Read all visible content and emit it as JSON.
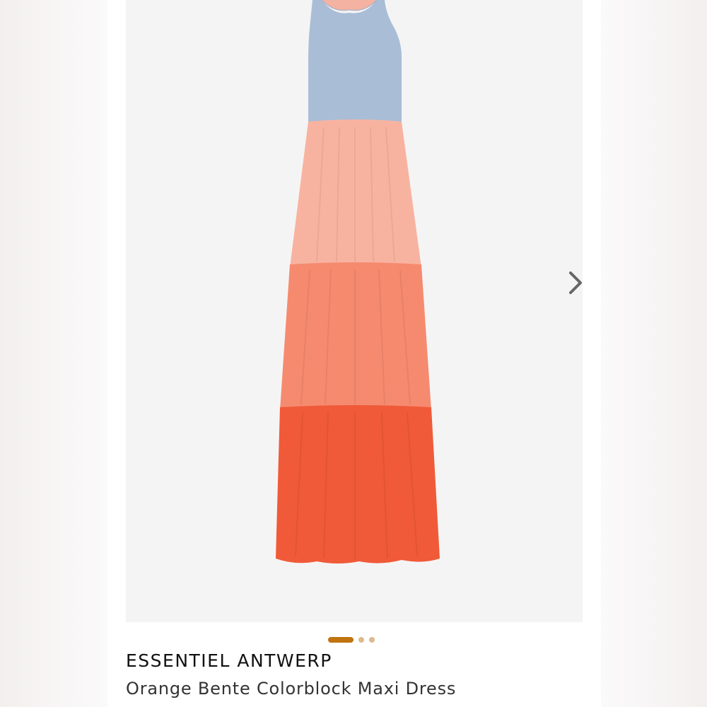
{
  "product": {
    "brand": "ESSENTIEL ANTWERP",
    "name": "Orange Bente Colorblock Maxi Dress"
  },
  "carousel": {
    "next_icon": "chevron-right-icon",
    "slide_count": 3,
    "active_slide": 1,
    "active_dot_color": "#c0730f",
    "inactive_dot_color": "#ddb98f"
  },
  "dress_colors": {
    "bodice": "#a9bdd6",
    "tier_1": "#f8b3a0",
    "tier_2": "#f58a6f",
    "tier_3": "#f05a38"
  }
}
